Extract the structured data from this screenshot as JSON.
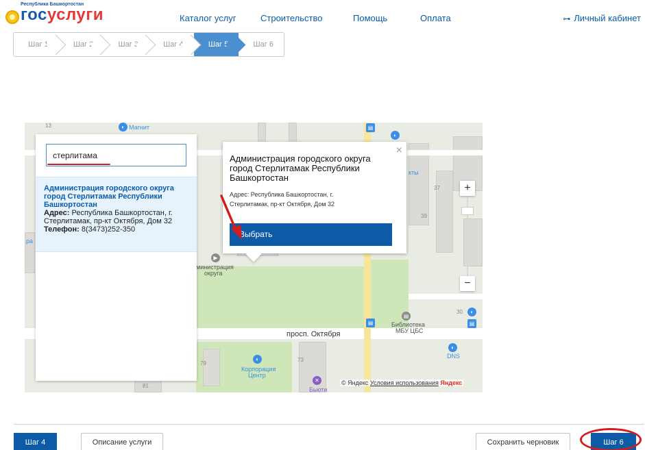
{
  "header": {
    "logo_region": "Республика Башкортостан",
    "logo_part1": "гос",
    "logo_part2": "услуги",
    "nav": [
      "Каталог услуг",
      "Строительство",
      "Помощь",
      "Оплата"
    ],
    "cabinet_icon": "key-icon",
    "cabinet_label": "Личный кабинет"
  },
  "steps": [
    "Шаг 1",
    "Шаг 2",
    "Шаг 3",
    "Шаг 4",
    "Шаг 5",
    "Шаг 6"
  ],
  "active_step": "Шаг 5",
  "search": {
    "value": "стерлитама"
  },
  "result": {
    "title": "Администрация городского округа город Стерлитамак Республики Башкортостан",
    "addr_label": "Адрес:",
    "addr_value": "Республика Башкортостан, г. Стерлитамак, пр-кт Октября, Дом 32",
    "phone_label": "Телефон:",
    "phone_value": "8(3473)252-350"
  },
  "popup": {
    "title": "Администрация городского округа город Стерлитамак Республики Башкортостан",
    "address": "Адрес: Республика Башкортостан, г. Стерлитамак, пр-кт Октября, Дом 32",
    "button": "Выбрать",
    "close": "×"
  },
  "map": {
    "labels": {
      "magnit": "Магнит",
      "admin_1": "министрация",
      "admin_2": "округа",
      "street": "просп. Октября",
      "library_1": "Библиотека",
      "library_2": "МБУ ЦБС",
      "dns": "DNS",
      "corp_1": "Корпорация",
      "corp_2": "Центр",
      "beauty": "Бьюти",
      "kty": "кты",
      "ra": "ра"
    },
    "numbers": [
      "13",
      "37",
      "39",
      "30",
      "79",
      "73",
      "81"
    ],
    "zoom_in": "+",
    "zoom_out": "−",
    "attribution": "© Яндекс",
    "terms": "Условия использования",
    "yandex": "Яндекс"
  },
  "footer": {
    "prev": "Шаг 4",
    "description": "Описание услуги",
    "save_draft": "Сохранить черновик",
    "next": "Шаг 6"
  },
  "colors": {
    "brand_blue": "#0d5aa7",
    "active_step": "#4b8fd0",
    "annotation_red": "#d31c1c",
    "result_bg": "#e6f3fc"
  }
}
